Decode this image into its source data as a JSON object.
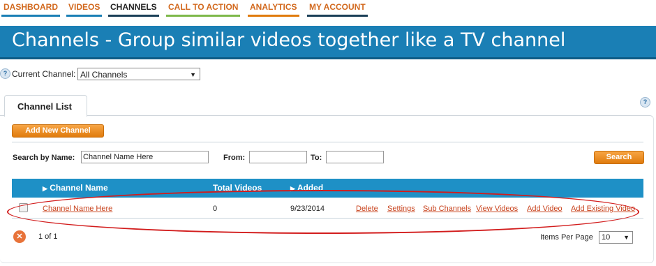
{
  "nav": {
    "items": [
      {
        "label": "DASHBOARD",
        "style": "orange",
        "bar_color": "#1a7fb5"
      },
      {
        "label": "VIDEOS",
        "style": "orange",
        "bar_color": "#1a7fb5"
      },
      {
        "label": "CHANNELS",
        "style": "dark",
        "bar_color": "#1a3f57",
        "active": true
      },
      {
        "label": "CALL TO ACTION",
        "style": "orange",
        "bar_color": "#7db84a"
      },
      {
        "label": "ANALYTICS",
        "style": "orange",
        "bar_color": "#e07b0d"
      },
      {
        "label": "MY ACCOUNT",
        "style": "orange",
        "bar_color": "#1a3f57"
      }
    ]
  },
  "banner": {
    "title": "Channels - Group similar videos together like a TV channel"
  },
  "current_channel": {
    "label": "Current Channel:",
    "value": "All Channels"
  },
  "tabs": {
    "channel_list": "Channel List"
  },
  "buttons": {
    "add_new_channel": "Add New Channel",
    "search": "Search"
  },
  "search": {
    "name_label": "Search by Name:",
    "name_value": "Channel Name Here",
    "from_label": "From:",
    "to_label": "To:"
  },
  "table": {
    "headers": {
      "name": "Channel Name",
      "total_videos": "Total Videos",
      "added": "Added"
    },
    "rows": [
      {
        "name": "Channel Name Here",
        "total_videos": "0",
        "added": "9/23/2014",
        "actions": [
          "Delete",
          "Settings",
          "Sub Channels",
          "View Videos",
          "Add Video",
          "Add Existing Video"
        ]
      }
    ]
  },
  "pager": {
    "text": "1 of 1",
    "items_per_page_label": "Items Per Page",
    "items_per_page": "10"
  },
  "colors": {
    "brand_blue": "#1a7fb5",
    "table_header": "#1e90c6",
    "accent_orange": "#e07b0d",
    "link": "#c8421c",
    "annotation_ring": "#d21c1c"
  }
}
